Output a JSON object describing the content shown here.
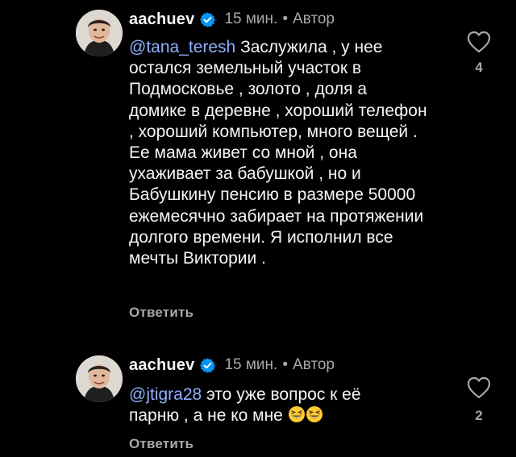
{
  "comments": [
    {
      "username": "aachuev",
      "time": "15 мин.",
      "separator": "•",
      "role": "Автор",
      "mention": "@tana_teresh",
      "text": " Заслужила , у нее остался земельный участок в Подмосковье , золото , доля а домике в деревне , хороший телефон , хороший компьютер, много вещей . Ее мама живет со мной , она ухаживает за бабушкой , но и Бабушкину пенсию в размере 50000 ежемесячно забирает на протяжении долгого времени. Я исполнил все мечты Виктории .",
      "reply_label": "Ответить",
      "like_count": "4"
    },
    {
      "username": "aachuev",
      "time": "15 мин.",
      "separator": "•",
      "role": "Автор",
      "mention": "@jtigra28",
      "text": " это уже вопрос к её парню , а не ко мне ",
      "emoji": "😆😆",
      "reply_label": "Ответить",
      "like_count": "2"
    }
  ],
  "colors": {
    "background": "#000000",
    "text": "#f5f5f5",
    "muted": "#a8a8a8",
    "mention": "#8fb0ff",
    "verified": "#0095f6"
  },
  "icons": {
    "verified": "verified-badge-icon",
    "like": "heart-outline-icon"
  }
}
